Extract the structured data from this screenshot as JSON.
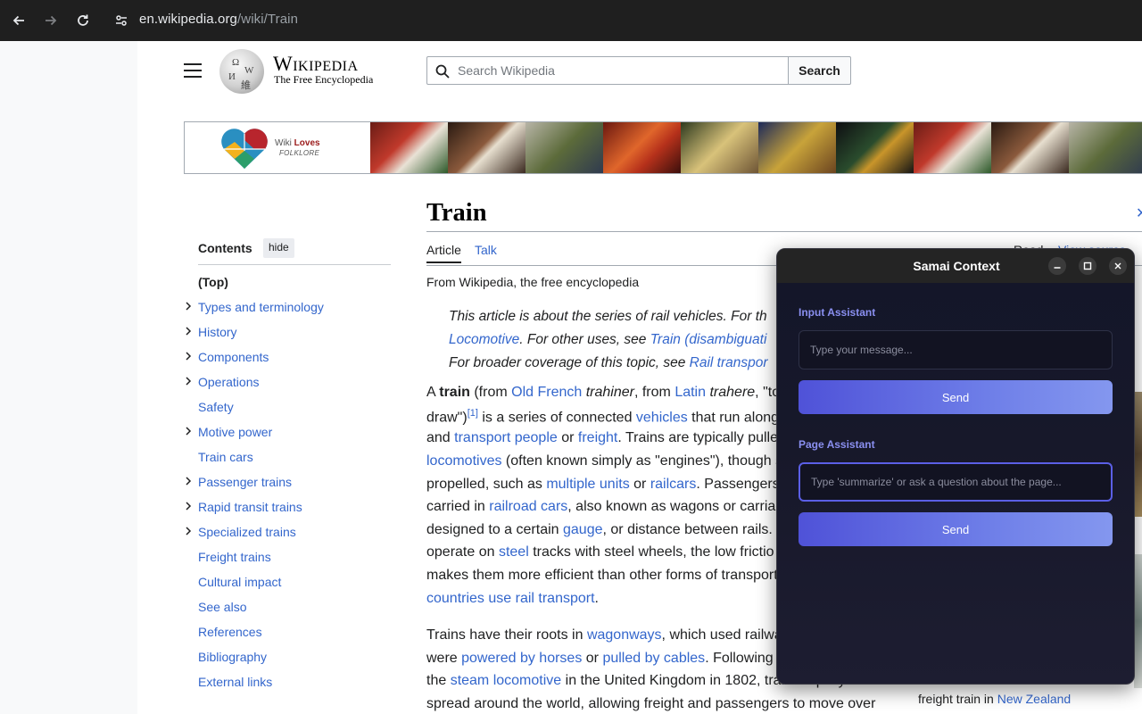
{
  "browser": {
    "url_host": "en.wikipedia.org",
    "url_path": "/wiki/Train"
  },
  "header": {
    "wordmark": "Wikipedia",
    "tagline": "The Free Encyclopedia",
    "search_placeholder": "Search Wikipedia",
    "search_button": "Search"
  },
  "banner": {
    "title_prefix": "Wiki ",
    "title_bold": "Loves",
    "subtitle": "FOLKLORE"
  },
  "article": {
    "title": "Train",
    "tabs": {
      "article": "Article",
      "talk": "Talk",
      "read": "Read",
      "view_source": "View source"
    },
    "sitesub": "From Wikipedia, the free encyclopedia",
    "hatnote": {
      "l1a": "This article is about the series of rail vehicles. For th",
      "l2a": "Locomotive",
      "l2b": ". For other uses, see ",
      "l2c": "Train (disambiguati",
      "l3a": "For broader coverage of this topic, see ",
      "l3b": "Rail transpor"
    },
    "p1": {
      "l1": [
        "A ",
        "train",
        " (from ",
        "Old French",
        " ",
        "trahiner",
        ", from ",
        "Latin",
        " ",
        "trahere",
        ", \"to"
      ],
      "l2": [
        "draw\")",
        "[1]",
        " is a series of connected ",
        "vehicles",
        " that run along"
      ],
      "l3": [
        "and ",
        "transport people",
        " or ",
        "freight",
        ". Trains are typically pulle"
      ],
      "l4": [
        "locomotives",
        " (often known simply as \"engines\"), though s"
      ],
      "l5": [
        "propelled, such as ",
        "multiple units",
        " or ",
        "railcars",
        ". Passengers"
      ],
      "l6": [
        "carried in ",
        "railroad cars",
        ", also known as wagons or carriag"
      ],
      "l7": [
        "designed to a certain ",
        "gauge",
        ", or distance between rails."
      ],
      "l8": [
        "operate on ",
        "steel",
        " tracks with steel wheels, the low frictio"
      ],
      "l9": [
        "makes them more efficient than other forms of transport"
      ],
      "l10": [
        "countries use rail transport",
        "."
      ]
    },
    "p2": {
      "l1": [
        "Trains have their roots in ",
        "wagonways",
        ", which used railwa"
      ],
      "l2": [
        "were ",
        "powered by horses",
        " or ",
        "pulled by cables",
        ". Following"
      ],
      "l3": [
        "the ",
        "steam locomotive",
        " in the United Kingdom in 1802, trains rapidly"
      ],
      "l4": [
        "spread around the world, allowing freight and passengers to move over"
      ]
    },
    "caption": [
      "freight train in ",
      "New Zealand"
    ]
  },
  "toc": {
    "title": "Contents",
    "hide": "hide",
    "items": [
      {
        "label": "(Top)",
        "expandable": false
      },
      {
        "label": "Types and terminology",
        "expandable": true
      },
      {
        "label": "History",
        "expandable": true
      },
      {
        "label": "Components",
        "expandable": true
      },
      {
        "label": "Operations",
        "expandable": true
      },
      {
        "label": "Safety",
        "expandable": false
      },
      {
        "label": "Motive power",
        "expandable": true
      },
      {
        "label": "Train cars",
        "expandable": false
      },
      {
        "label": "Passenger trains",
        "expandable": true
      },
      {
        "label": "Rapid transit trains",
        "expandable": true
      },
      {
        "label": "Specialized trains",
        "expandable": true
      },
      {
        "label": "Freight trains",
        "expandable": false
      },
      {
        "label": "Cultural impact",
        "expandable": false
      },
      {
        "label": "See also",
        "expandable": false
      },
      {
        "label": "References",
        "expandable": false
      },
      {
        "label": "Bibliography",
        "expandable": false
      },
      {
        "label": "External links",
        "expandable": false
      }
    ]
  },
  "samai": {
    "title": "Samai Context",
    "input_label": "Input Assistant",
    "input_placeholder": "Type your message...",
    "input_send": "Send",
    "page_label": "Page Assistant",
    "page_placeholder": "Type 'summarize' or ask a question about the page...",
    "page_send": "Send"
  },
  "colors": {
    "link": "#3366cc",
    "accent": "#5b5fe6",
    "chrome_bg": "#1f1f1f"
  }
}
